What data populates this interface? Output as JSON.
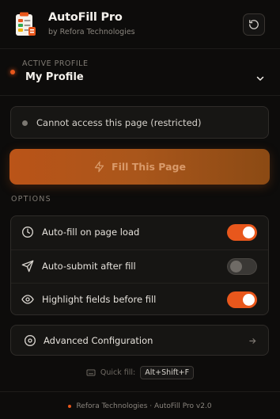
{
  "app": {
    "title": "AutoFill Pro",
    "subtitle": "by Refora Technologies",
    "logo_icon": "clipboard-form-icon",
    "refresh_icon": "refresh-icon"
  },
  "profile": {
    "label": "ACTIVE PROFILE",
    "selected": "My Profile",
    "indicator_color": "#e8571c"
  },
  "status": {
    "text": "Cannot access this page (restricted)",
    "dot_color": "#7b7771"
  },
  "fill_button": {
    "label": "Fill This Page",
    "icon": "lightning-icon",
    "state": "disabled"
  },
  "options": {
    "section_label": "OPTIONS",
    "items": [
      {
        "label": "Auto-fill on page load",
        "icon": "clock-icon",
        "enabled": true
      },
      {
        "label": "Auto-submit after fill",
        "icon": "send-icon",
        "enabled": false
      },
      {
        "label": "Highlight fields before fill",
        "icon": "eye-icon",
        "enabled": true
      }
    ]
  },
  "advanced": {
    "label": "Advanced Configuration",
    "icon": "target-icon",
    "arrow_icon": "arrow-right-icon"
  },
  "quick_fill": {
    "label": "Quick fill:",
    "shortcut": "Alt+Shift+F",
    "icon": "keyboard-icon"
  },
  "footer": {
    "text": "Refora Technologies · AutoFill Pro v2.0"
  },
  "colors": {
    "accent": "#e8571c",
    "background": "#0d0c0b",
    "card": "#161513"
  }
}
